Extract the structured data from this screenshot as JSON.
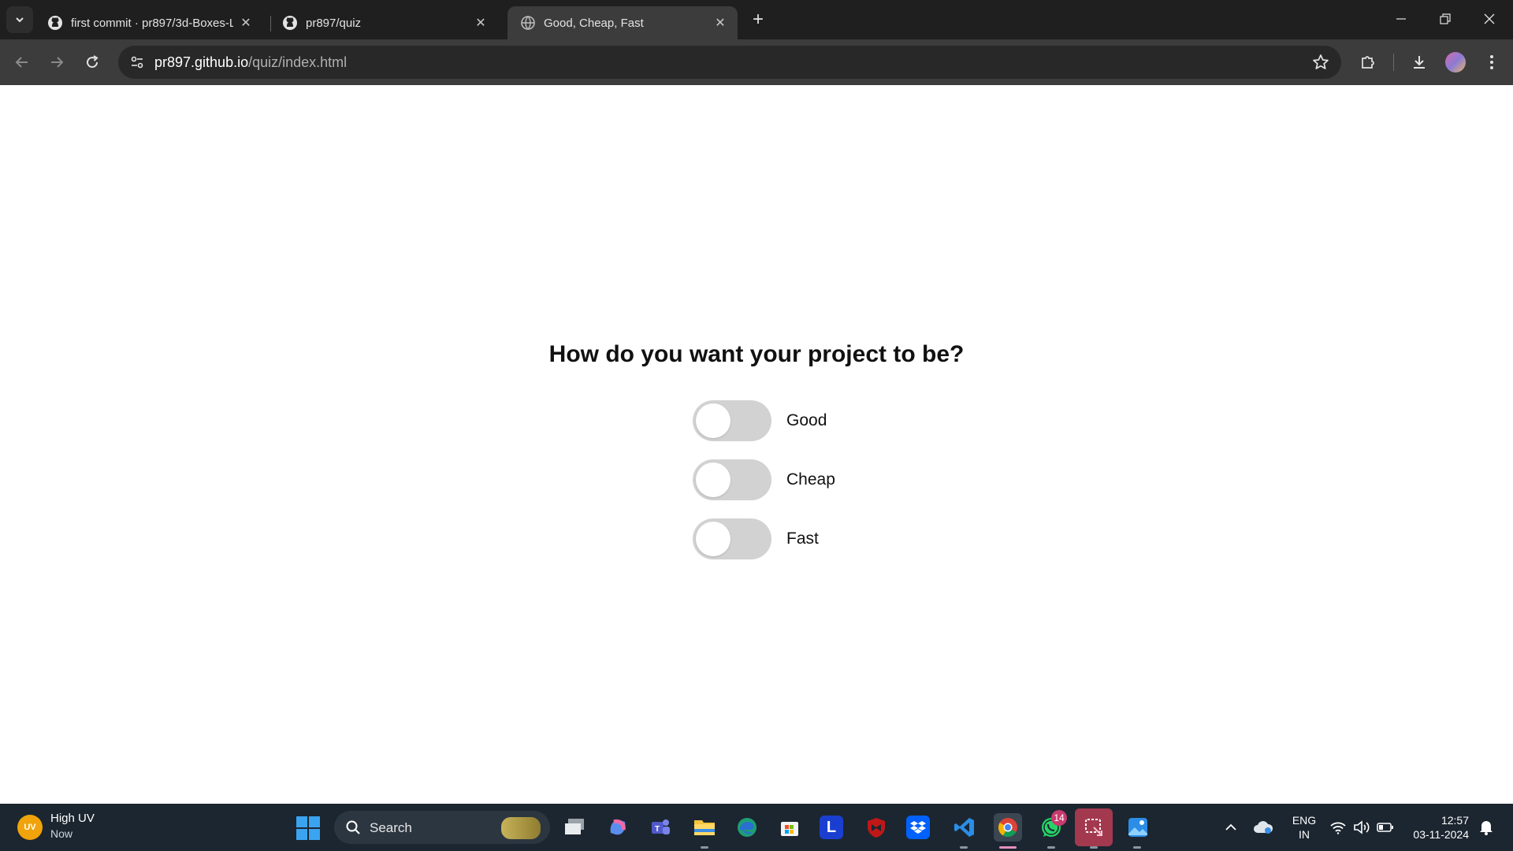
{
  "browser": {
    "tabs": [
      {
        "label": "first commit · pr897/3d-Boxes-L",
        "icon": "github-icon",
        "active": false
      },
      {
        "label": "pr897/quiz",
        "icon": "github-icon",
        "active": false
      },
      {
        "label": "Good, Cheap, Fast",
        "icon": "globe-icon",
        "active": true
      }
    ],
    "url_domain": "pr897.github.io",
    "url_path": "/quiz/index.html"
  },
  "page": {
    "question": "How do you want your project to be?",
    "options": [
      {
        "label": "Good",
        "checked": false
      },
      {
        "label": "Cheap",
        "checked": false
      },
      {
        "label": "Fast",
        "checked": false
      }
    ]
  },
  "taskbar": {
    "weather_badge": "UV",
    "weather_title": "High UV",
    "weather_sub": "Now",
    "search_label": "Search",
    "whatsapp_badge": "14",
    "lang_line1": "ENG",
    "lang_line2": "IN",
    "time": "12:57",
    "date": "03-11-2024"
  },
  "colors": {
    "toggle_off": "#d2d2d2",
    "titlebar": "#1f1f1f",
    "toolbar": "#3c3c3c",
    "taskbar": "#1c2630"
  }
}
